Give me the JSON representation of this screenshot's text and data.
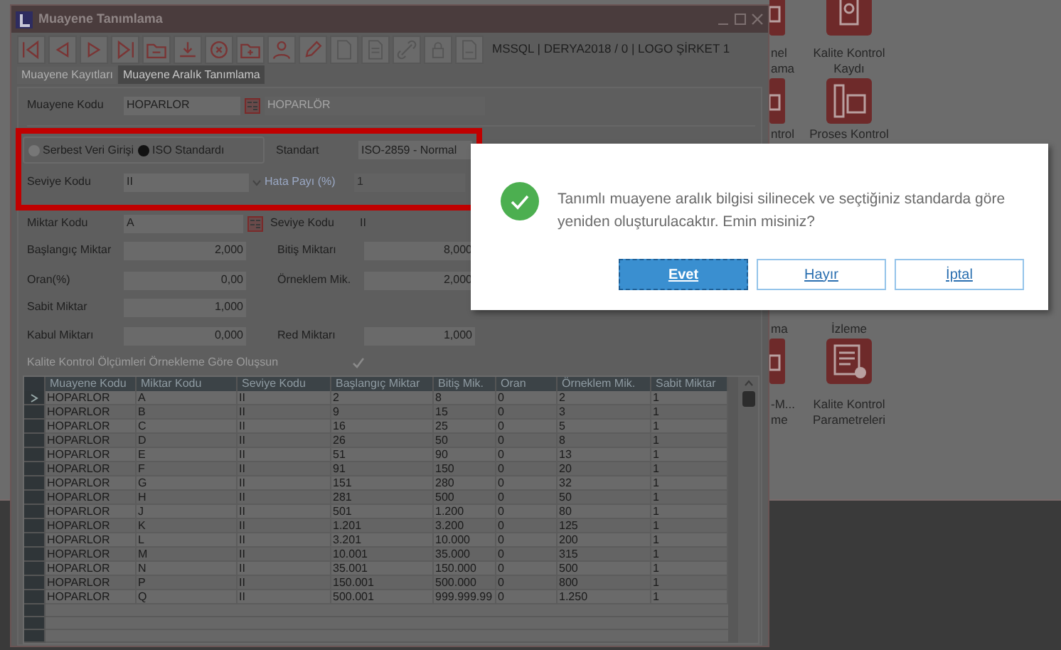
{
  "desktop": {
    "tiles": [
      {
        "kind": "partial",
        "lines": [
          "nel",
          "ama"
        ]
      },
      {
        "kind": "partial",
        "lines": [
          "ntrol"
        ]
      },
      {
        "kind": "partial",
        "lines": [
          "ma"
        ]
      },
      {
        "kind": "partial",
        "lines": [
          "-M...",
          "me"
        ]
      },
      {
        "kind": "full",
        "lines": [
          "Kalite Kontrol",
          "Kaydı"
        ]
      },
      {
        "kind": "full",
        "lines": [
          "Proses Kontrol"
        ]
      },
      {
        "kind": "label",
        "lines": [
          "İzleme"
        ]
      },
      {
        "kind": "full",
        "lines": [
          "Kalite Kontrol",
          "Parametreleri"
        ]
      }
    ]
  },
  "window": {
    "title": "Muayene Tanımlama"
  },
  "toolbar": {
    "connection": "MSSQL | DERYA2018 / 0 | LOGO ŞİRKET 1"
  },
  "tabs": [
    {
      "label": "Muayene Kayıtları",
      "selected": false
    },
    {
      "label": "Muayene Aralık Tanımlama",
      "selected": true
    }
  ],
  "muayene_kodu": {
    "label": "Muayene Kodu",
    "value": "HOPARLOR",
    "description": "HOPARLÖR"
  },
  "entry_mode": [
    {
      "label": "Serbest Veri Girişi",
      "selected": false
    },
    {
      "label": "ISO Standardı",
      "selected": true
    }
  ],
  "standart": {
    "label": "Standart",
    "value": "ISO-2859 - Normal"
  },
  "seviye_kodu": {
    "label": "Seviye Kodu",
    "value": "II"
  },
  "hata_payi": {
    "label": "Hata Payı (%)",
    "value": "1",
    "disabled": true
  },
  "detail_rows": [
    {
      "left": {
        "label": "Miktar Kodu",
        "value": "A",
        "kind": "lookup"
      },
      "right": {
        "label": "Seviye Kodu",
        "value": "II",
        "kind": "plain"
      }
    },
    {
      "left": {
        "label": "Başlangıç Miktar",
        "value": "2,000",
        "kind": "number"
      },
      "right": {
        "label": "Bitiş Miktarı",
        "value": "8,000",
        "kind": "number"
      }
    },
    {
      "left": {
        "label": "Oran(%)",
        "value": "0,00",
        "kind": "number"
      },
      "right": {
        "label": "Örneklem Mik.",
        "value": "2,000",
        "kind": "number"
      }
    },
    {
      "left": {
        "label": "Sabit Miktar",
        "value": "1,000",
        "kind": "number"
      }
    },
    {
      "left": {
        "label": "Kabul Miktarı",
        "value": "0,000",
        "kind": "number"
      },
      "right": {
        "label": "Red Miktarı",
        "value": "1,000",
        "kind": "number"
      }
    }
  ],
  "sampling_checkbox": {
    "label": "Kalite Kontrol Ölçümleri Örnekleme Göre Oluşsun",
    "checked": true
  },
  "grid": {
    "columns": [
      "Muayene Kodu",
      "Miktar Kodu",
      "Seviye Kodu",
      "Başlangıç Miktar",
      "Bitiş Mik.",
      "Oran",
      "Örneklem Mik.",
      "Sabit Miktar"
    ],
    "rows": [
      {
        "selected": true,
        "cells": [
          "HOPARLOR",
          "A",
          "II",
          "2",
          "8",
          "0",
          "2",
          "1"
        ]
      },
      {
        "selected": false,
        "cells": [
          "HOPARLOR",
          "B",
          "II",
          "9",
          "15",
          "0",
          "3",
          "1"
        ]
      },
      {
        "selected": false,
        "cells": [
          "HOPARLOR",
          "C",
          "II",
          "16",
          "25",
          "0",
          "5",
          "1"
        ]
      },
      {
        "selected": false,
        "cells": [
          "HOPARLOR",
          "D",
          "II",
          "26",
          "50",
          "0",
          "8",
          "1"
        ]
      },
      {
        "selected": false,
        "cells": [
          "HOPARLOR",
          "E",
          "II",
          "51",
          "90",
          "0",
          "13",
          "1"
        ]
      },
      {
        "selected": false,
        "cells": [
          "HOPARLOR",
          "F",
          "II",
          "91",
          "150",
          "0",
          "20",
          "1"
        ]
      },
      {
        "selected": false,
        "cells": [
          "HOPARLOR",
          "G",
          "II",
          "151",
          "280",
          "0",
          "32",
          "1"
        ]
      },
      {
        "selected": false,
        "cells": [
          "HOPARLOR",
          "H",
          "II",
          "281",
          "500",
          "0",
          "50",
          "1"
        ]
      },
      {
        "selected": false,
        "cells": [
          "HOPARLOR",
          "J",
          "II",
          "501",
          "1.200",
          "0",
          "80",
          "1"
        ]
      },
      {
        "selected": false,
        "cells": [
          "HOPARLOR",
          "K",
          "II",
          "1.201",
          "3.200",
          "0",
          "125",
          "1"
        ]
      },
      {
        "selected": false,
        "cells": [
          "HOPARLOR",
          "L",
          "II",
          "3.201",
          "10.000",
          "0",
          "200",
          "1"
        ]
      },
      {
        "selected": false,
        "cells": [
          "HOPARLOR",
          "M",
          "II",
          "10.001",
          "35.000",
          "0",
          "315",
          "1"
        ]
      },
      {
        "selected": false,
        "cells": [
          "HOPARLOR",
          "N",
          "II",
          "35.001",
          "150.000",
          "0",
          "500",
          "1"
        ]
      },
      {
        "selected": false,
        "cells": [
          "HOPARLOR",
          "P",
          "II",
          "150.001",
          "500.000",
          "0",
          "800",
          "1"
        ]
      },
      {
        "selected": false,
        "cells": [
          "HOPARLOR",
          "Q",
          "II",
          "500.001",
          "999.999.99",
          "0",
          "1.250",
          "1"
        ]
      }
    ]
  },
  "dialog": {
    "message": "Tanımlı muayene aralık bilgisi silinecek ve seçtiğiniz standarda göre yeniden oluşturulacaktır. Emin misiniz?",
    "buttons": [
      {
        "label": "Evet",
        "default": true
      },
      {
        "label": "Hayır",
        "default": false
      },
      {
        "label": "İptal",
        "default": false
      }
    ]
  }
}
